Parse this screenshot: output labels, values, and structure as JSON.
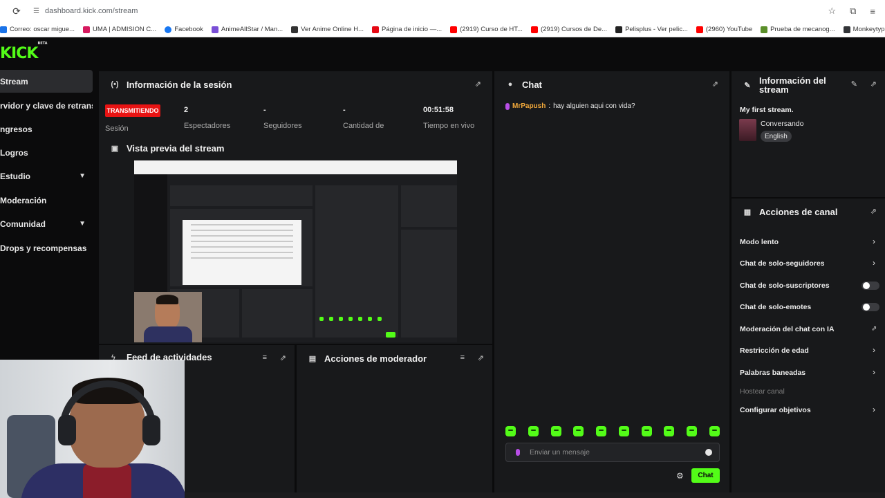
{
  "browser": {
    "url": "dashboard.kick.com/stream",
    "bookmarks": [
      {
        "label": "Correo: oscar migue...",
        "color": "#1a73e8"
      },
      {
        "label": "UMA | ADMISION C...",
        "color": "#d61a5f"
      },
      {
        "label": "Facebook",
        "color": "#1877f2"
      },
      {
        "label": "AnimeAllStar / Man...",
        "color": "#7a4fd6"
      },
      {
        "label": "Ver Anime Online H...",
        "color": "#333333"
      },
      {
        "label": "Página de inicio —...",
        "color": "#e50914"
      },
      {
        "label": "(2919) Curso de HT...",
        "color": "#ff0000"
      },
      {
        "label": "(2919) Cursos de De...",
        "color": "#ff0000"
      },
      {
        "label": "Pelisplus - Ver pelic...",
        "color": "#222222"
      },
      {
        "label": "(2960) YouTube",
        "color": "#ff0000"
      },
      {
        "label": "Prueba de mecanog...",
        "color": "#5b8f2a"
      },
      {
        "label": "Monkeytype | A min...",
        "color": "#323437"
      }
    ]
  },
  "brand": {
    "logo": "KICK",
    "beta": "BETA",
    "accent": "#53fc18"
  },
  "sidebar": {
    "items": [
      {
        "label": "Stream"
      },
      {
        "label": "rvidor y clave de retransm"
      },
      {
        "label": "ngresos"
      },
      {
        "label": "Logros"
      },
      {
        "label": "Estudio",
        "chevron": "⌄"
      },
      {
        "label": "Moderación"
      },
      {
        "label": "Comunidad",
        "chevron": "⌄"
      },
      {
        "label": "Drops y recompensas"
      }
    ]
  },
  "session": {
    "title": "Información de la sesión",
    "status": "TRANSMITIENDO",
    "status_label": "Sesión",
    "stats": [
      {
        "value": "2",
        "label": "Espectadores"
      },
      {
        "value": "-",
        "label": "Seguidores"
      },
      {
        "value": "-",
        "label": "Cantidad de"
      },
      {
        "value": "00:51:58",
        "label": "Tiempo en vivo"
      }
    ]
  },
  "preview": {
    "title": "Vista previa del stream"
  },
  "activity": {
    "title": "Feed de actividades"
  },
  "moderator": {
    "title": "Acciones de moderador"
  },
  "chat": {
    "title": "Chat",
    "messages": [
      {
        "user": "MrPapush",
        "text": "hay alguien aqui con vida?"
      }
    ],
    "input_placeholder": "Enviar un mensaje",
    "send_label": "Chat"
  },
  "stream_info": {
    "title": "Información del stream",
    "stream_title": "My first stream.",
    "category": "Conversando",
    "tag": "English"
  },
  "channel_actions": {
    "title": "Acciones de canal",
    "items": [
      {
        "label": "Modo lento",
        "control": "chevron"
      },
      {
        "label": "Chat de solo-seguidores",
        "control": "chevron"
      },
      {
        "label": "Chat de solo-suscriptores",
        "control": "toggle",
        "enabled": false
      },
      {
        "label": "Chat de solo-emotes",
        "control": "toggle",
        "enabled": false
      },
      {
        "label": "Moderación del chat con IA",
        "control": "external"
      },
      {
        "label": "Restricción de edad",
        "control": "chevron"
      },
      {
        "label": "Palabras baneadas",
        "control": "chevron"
      },
      {
        "label": "Hostear canal",
        "control": "none",
        "disabled": true
      },
      {
        "label": "Configurar objetivos",
        "control": "chevron"
      }
    ]
  }
}
